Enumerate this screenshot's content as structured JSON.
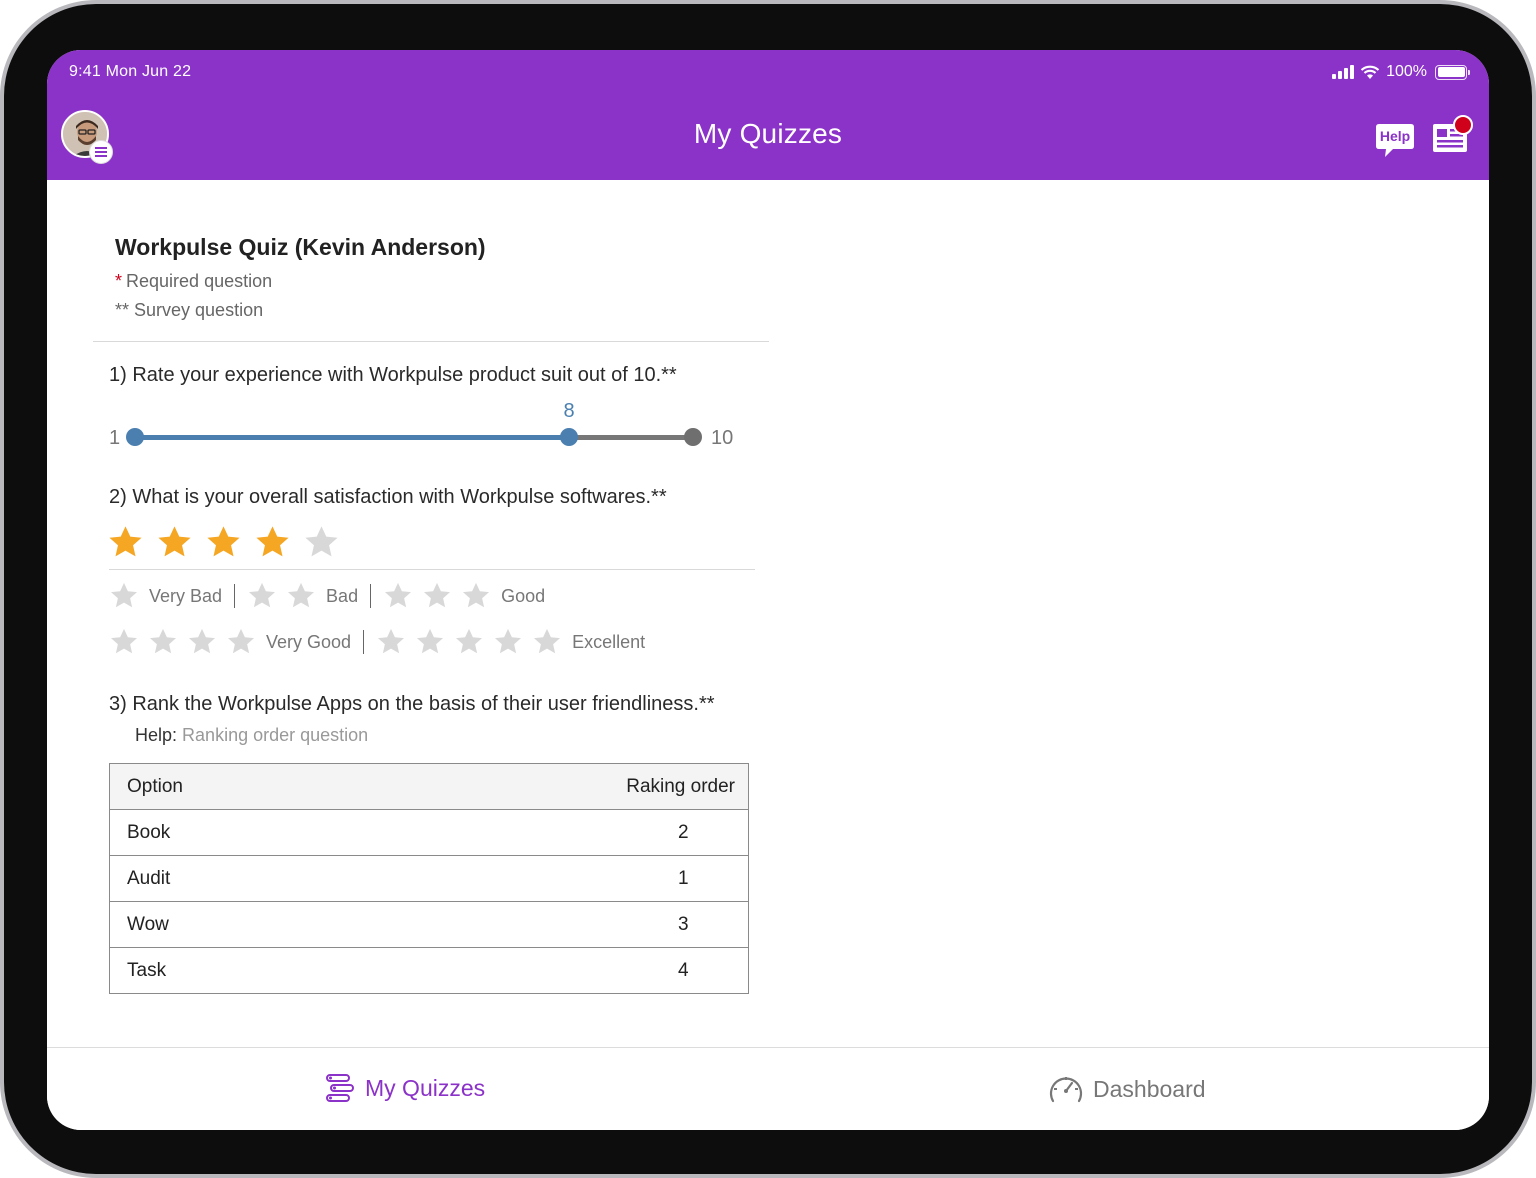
{
  "status_bar": {
    "time": "9:41 Mon Jun 22",
    "battery": "100%"
  },
  "header": {
    "title": "My Quizzes",
    "help_label": "Help"
  },
  "quiz": {
    "title": "Workpulse Quiz (Kevin Anderson)",
    "required_marker": "*",
    "required_legend": "Required question",
    "survey_legend": "** Survey question"
  },
  "question1": {
    "text": "1) Rate your experience with Workpulse product suit out of 10.**",
    "min": 1,
    "max": 10,
    "value": 8,
    "min_label": "1",
    "max_label": "10",
    "value_label": "8"
  },
  "question2": {
    "text": "2) What is your overall satisfaction with Workpulse softwares.**",
    "rating": 4,
    "max_rating": 5,
    "legend": [
      {
        "stars": 1,
        "label": "Very Bad"
      },
      {
        "stars": 2,
        "label": "Bad"
      },
      {
        "stars": 3,
        "label": "Good"
      },
      {
        "stars": 4,
        "label": "Very Good"
      },
      {
        "stars": 5,
        "label": "Excellent"
      }
    ]
  },
  "question3": {
    "text": "3) Rank the Workpulse Apps on the basis of their user friendliness.**",
    "help_label": "Help:",
    "help_text": "Ranking order question",
    "columns": [
      "Option",
      "Raking order"
    ],
    "rows": [
      {
        "option": "Book",
        "rank": "2"
      },
      {
        "option": "Audit",
        "rank": "1"
      },
      {
        "option": "Wow",
        "rank": "3"
      },
      {
        "option": "Task",
        "rank": "4"
      }
    ]
  },
  "tabs": [
    {
      "label": "My Quizzes",
      "active": true
    },
    {
      "label": "Dashboard",
      "active": false
    }
  ],
  "colors": {
    "brand": "#8b32c8",
    "slider_fill": "#4a7fb0",
    "star_active": "#f5a623",
    "star_inactive": "#d8d8d8",
    "notification": "#d0021b"
  }
}
